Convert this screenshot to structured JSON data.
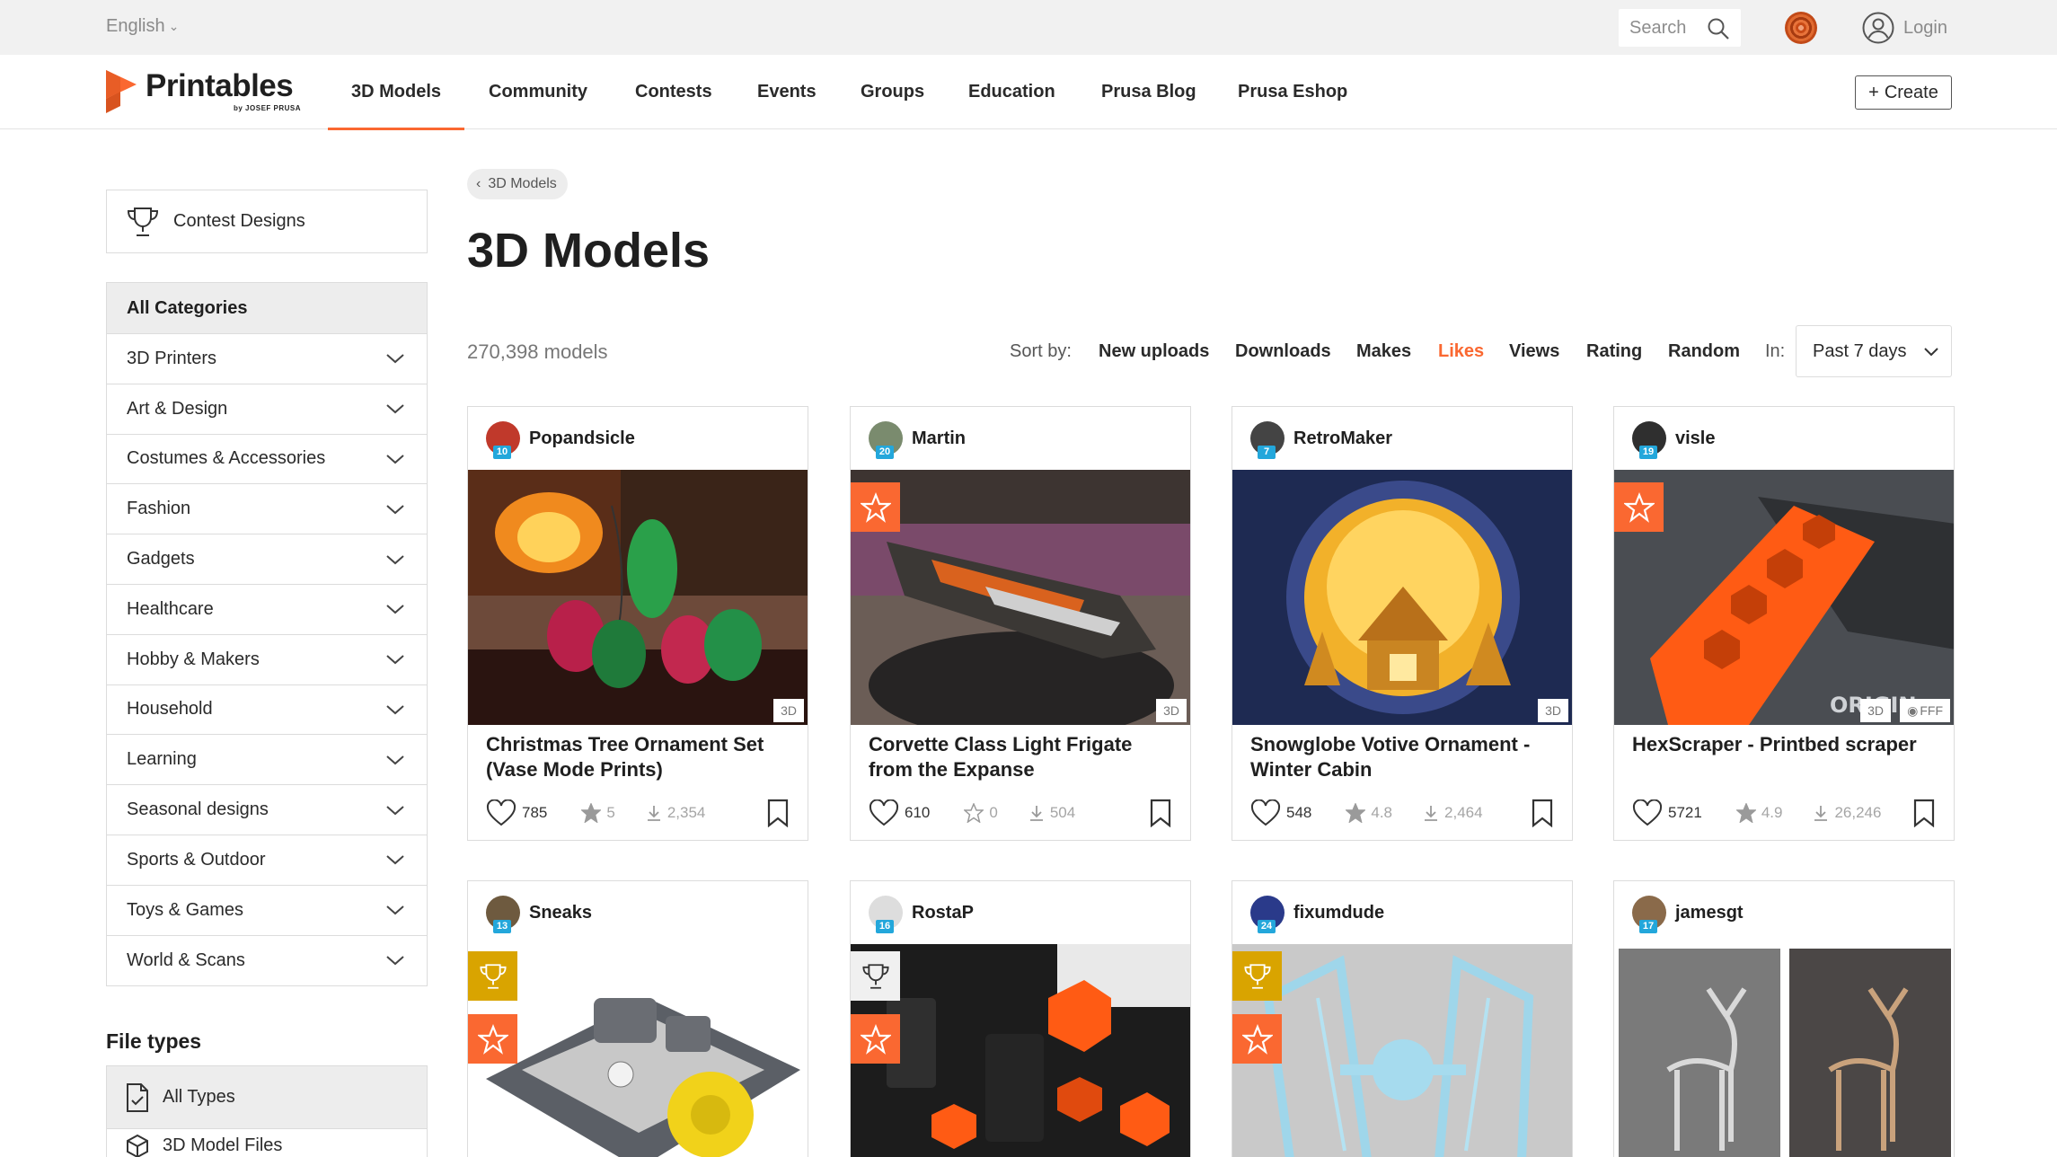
{
  "topbar": {
    "language": "English",
    "search_placeholder": "Search",
    "login_label": "Login"
  },
  "brand": {
    "name": "Printables",
    "sub": "by JOSEF PRUSA",
    "accent": "#fa6831"
  },
  "nav": {
    "items": [
      "3D Models",
      "Community",
      "Contests",
      "Events",
      "Groups",
      "Education",
      "Prusa Blog",
      "Prusa Eshop"
    ],
    "active": "3D Models",
    "create_label": "Create"
  },
  "sidebar": {
    "contest_label": "Contest Designs",
    "all_categories": "All Categories",
    "categories": [
      "3D Printers",
      "Art & Design",
      "Costumes & Accessories",
      "Fashion",
      "Gadgets",
      "Healthcare",
      "Hobby & Makers",
      "Household",
      "Learning",
      "Seasonal designs",
      "Sports & Outdoor",
      "Toys & Games",
      "World & Scans"
    ],
    "file_types_title": "File types",
    "file_types": [
      "All Types",
      "3D Model Files"
    ]
  },
  "main": {
    "breadcrumb": "3D Models",
    "title": "3D Models",
    "count": "270,398 models",
    "sort_label": "Sort by:",
    "sort_options": [
      "New uploads",
      "Downloads",
      "Makes",
      "Likes",
      "Views",
      "Rating",
      "Random"
    ],
    "sort_active": "Likes",
    "in_label": "In:",
    "period": "Past 7 days"
  },
  "cards": [
    {
      "author": "Popandsicle",
      "level": "10",
      "title": "Christmas Tree Ornament Set (Vase Mode Prints)",
      "likes": "785",
      "rating": "5",
      "downloads": "2,354",
      "tags": [
        "3D"
      ],
      "badges": []
    },
    {
      "author": "Martin",
      "level": "20",
      "title": "Corvette Class Light Frigate from the Expanse",
      "likes": "610",
      "rating": "0",
      "downloads": "504",
      "tags": [
        "3D"
      ],
      "badges": [
        "star"
      ]
    },
    {
      "author": "RetroMaker",
      "level": "7",
      "title": "Snowglobe Votive Ornament - Winter Cabin",
      "likes": "548",
      "rating": "4.8",
      "downloads": "2,464",
      "tags": [
        "3D"
      ],
      "badges": []
    },
    {
      "author": "visle",
      "level": "19",
      "title": "HexScraper - Printbed scraper",
      "likes": "5721",
      "rating": "4.9",
      "downloads": "26,246",
      "tags": [
        "3D",
        "FFF"
      ],
      "badges": [
        "star"
      ]
    },
    {
      "author": "Sneaks",
      "level": "13",
      "title": "",
      "likes": "",
      "rating": "",
      "downloads": "",
      "tags": [],
      "badges": [
        "trophy-gold",
        "star"
      ]
    },
    {
      "author": "RostaP",
      "level": "16",
      "title": "",
      "likes": "",
      "rating": "",
      "downloads": "",
      "tags": [],
      "badges": [
        "trophy-plain",
        "star"
      ]
    },
    {
      "author": "fixumdude",
      "level": "24",
      "title": "",
      "likes": "",
      "rating": "",
      "downloads": "",
      "tags": [],
      "badges": [
        "trophy-gold",
        "star"
      ]
    },
    {
      "author": "jamesgt",
      "level": "17",
      "title": "",
      "likes": "",
      "rating": "",
      "downloads": "",
      "tags": [],
      "badges": []
    }
  ]
}
